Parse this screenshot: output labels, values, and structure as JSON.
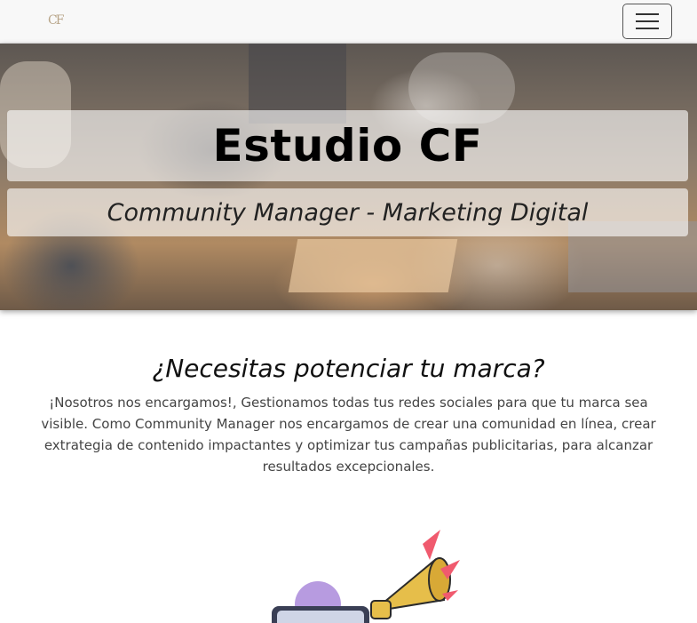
{
  "navbar": {
    "logo_text": "CF",
    "menu_icon": "hamburger-menu-icon"
  },
  "hero": {
    "title": "Estudio CF",
    "subtitle": "Community Manager - Marketing Digital"
  },
  "intro": {
    "heading": "¿Necesitas potenciar tu marca?",
    "body": "¡Nosotros nos encargamos!, Gestionamos todas tus redes sociales para que tu marca sea visible. Como Community Manager nos encargamos de crear una comunidad en línea, crear extrategia de contenido impactantes y optimizar tus campañas publicitarias, para alcanzar resultados excepcionales."
  },
  "illustration": {
    "icon": "megaphone-phone-illustration-icon",
    "accent_colors": [
      "#f05a6e",
      "#d8a936",
      "#b79be0",
      "#3a3f55"
    ]
  }
}
